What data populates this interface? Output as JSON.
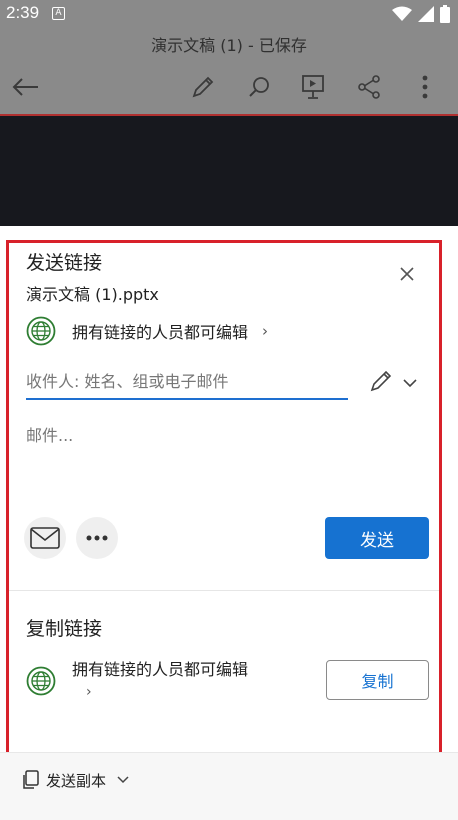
{
  "status_bar": {
    "time": "2:39",
    "badge": "A"
  },
  "document": {
    "title": "演示文稿 (1) - 已保存"
  },
  "toolbar": {
    "icons": [
      "back-arrow-icon",
      "pencil-icon",
      "search-icon",
      "present-icon",
      "share-icon",
      "more-vertical-icon"
    ]
  },
  "share_sheet": {
    "title": "发送链接",
    "file_name": "演示文稿 (1).pptx",
    "permission": "拥有链接的人员都可编辑",
    "permission_chevron": "›",
    "recipient_placeholder": "收件人: 姓名、组或电子邮件",
    "message_placeholder": "邮件...",
    "send_label": "发送"
  },
  "copy_link": {
    "title": "复制链接",
    "permission": "拥有链接的人员都可编辑",
    "permission_chevron": "›",
    "copy_label": "复制"
  },
  "bottom": {
    "send_copy_label": "发送副本"
  },
  "colors": {
    "accent": "#1672d1",
    "highlight": "#d8212a",
    "globe": "#2e7d32"
  }
}
